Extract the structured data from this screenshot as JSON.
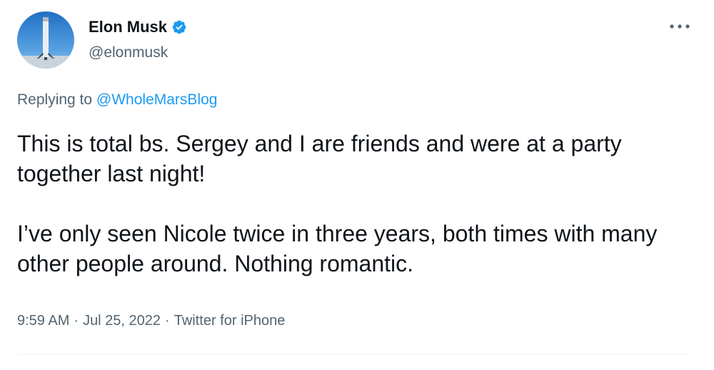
{
  "author": {
    "name": "Elon Musk",
    "handle": "@elonmusk",
    "avatar_icon": "rocket-avatar-icon",
    "verified_icon": "verified-badge-icon"
  },
  "reply": {
    "prefix": "Replying to ",
    "mention": "@WholeMarsBlog"
  },
  "tweet": {
    "paragraphs": [
      "This is total bs. Sergey and I are friends and were at a party together last night!",
      "I’ve only seen Nicole twice in three years, both times with many other people around. Nothing romantic."
    ]
  },
  "meta": {
    "time": "9:59 AM",
    "date": "Jul 25, 2022",
    "source": "Twitter for iPhone",
    "separator": "·"
  },
  "colors": {
    "text": "#0f1419",
    "secondary": "#536471",
    "accent": "#1d9bf0"
  }
}
